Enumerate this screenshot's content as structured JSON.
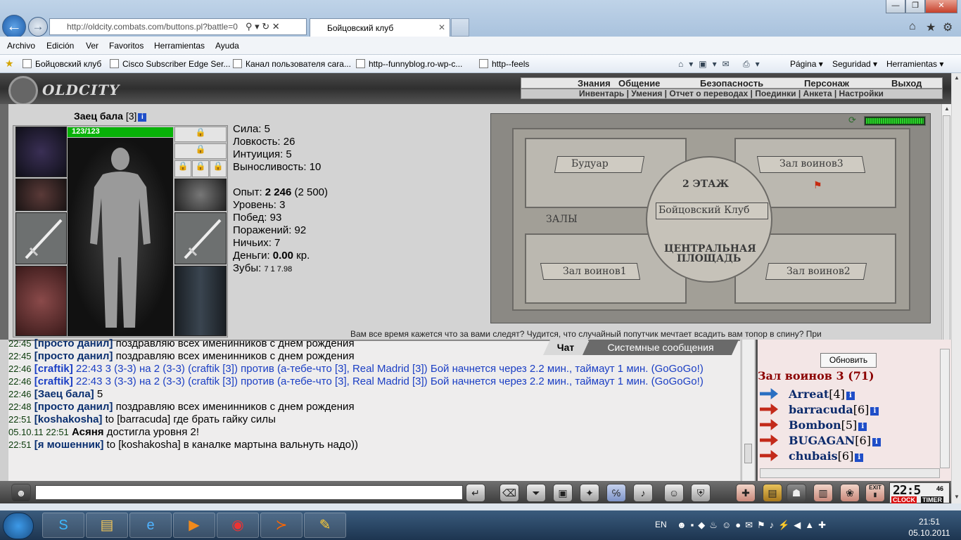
{
  "browser": {
    "address": "http://oldcity.combats.com/buttons.pl?battle=0",
    "tab_title": "Бойцовский клуб",
    "menu": [
      "Archivo",
      "Edición",
      "Ver",
      "Favoritos",
      "Herramientas",
      "Ayuda"
    ],
    "favorites": [
      "Бойцовский клуб",
      "Cisco Subscriber Edge Ser...",
      "Канал пользователя cara...",
      "http--funnyblog.ro-wp-c...",
      "http--feels"
    ],
    "commands": [
      "Página ▾",
      "Seguridad ▾",
      "Herramientas ▾"
    ],
    "icons": [
      "back-icon",
      "forward-icon",
      "home-icon",
      "star-icon",
      "gear-icon"
    ]
  },
  "game": {
    "logo": "OLDCITY",
    "top_menu": [
      "Знания",
      "Общение",
      "Безопасность",
      "Персонаж",
      "Выход"
    ],
    "sub_menu": "Инвентарь | Умения | Отчет о переводах | Поединки | Анкета | Настройки",
    "character": {
      "name": "Заец бала",
      "level": "[3]",
      "info": "i",
      "hp": "123/123",
      "hp_fraction": 1.0
    },
    "stats": {
      "strength": "Сила: 5",
      "agility": "Ловкость: 26",
      "intuition": "Интуиция: 5",
      "endurance": "Выносливость: 10",
      "exp_label": "Опыт: ",
      "exp_value": "2 246",
      "exp_next": " (2 500)",
      "level": "Уровень: 3",
      "wins": "Побед: 93",
      "losses": "Поражений: 92",
      "draws": "Ничьих: 7",
      "money_label": "Деньги: ",
      "money_value": "0.00",
      "money_unit": " кр.",
      "teeth_label": "Зубы: ",
      "teeth_values": "7  1  7.98"
    },
    "map": {
      "labels": [
        "Будуар",
        "Зал воинов3",
        "2 ЭТАЖ",
        "Бойцовский Клуб",
        "ЗАЛЫ",
        "ЦЕНТРАЛЬНАЯ",
        "ПЛОЩАДЬ",
        "Зал воинов1",
        "Зал воинов2"
      ]
    },
    "message_line": "Вам все время кажется что за вами следят? Чудится, что случайный попутчик мечтает всадить вам топор в спину? При",
    "chat_tabs": {
      "chat": "Чат",
      "system": "Системные сообщения"
    },
    "chat": [
      {
        "time": "22:45",
        "name": "[просто данил]",
        "text": " поздравляю всех именинников с днем рождения",
        "style": "normal"
      },
      {
        "time": "22:45",
        "name": "[просто данил]",
        "text": " поздравляю всех именинников с днем рождения",
        "style": "normal"
      },
      {
        "time": "22:46",
        "name": "[craftik]",
        "text": " 22:43 3 (3-3) на 2 (3-3) (craftik [3]) против (а-тебе-что [3], Real Madrid [3]) Бой начнется через 2.2 мин., таймаут 1 мин. (GoGoGo!)",
        "style": "blue"
      },
      {
        "time": "22:46",
        "name": "[craftik]",
        "text": " 22:43 3 (3-3) на 2 (3-3) (craftik [3]) против (а-тебе-что [3], Real Madrid [3]) Бой начнется через 2.2 мин., таймаут 1 мин. (GoGoGo!)",
        "style": "blue"
      },
      {
        "time": "22:46",
        "name": "[Заец бала]",
        "text": " 5",
        "style": "normal"
      },
      {
        "time": "22:48",
        "name": "[просто данил]",
        "text": " поздравляю всех именинников с днем рождения",
        "style": "normal"
      },
      {
        "time": "22:51",
        "name": "[koshakosha]",
        "text": " to [barracuda] где брать гайку силы",
        "style": "normal"
      },
      {
        "time": "05.10.11 22:51",
        "name": "Асяня",
        "text": " достигла уровня 2!",
        "style": "system"
      },
      {
        "time": "22:51",
        "name": "[я мошенник]",
        "text": " to [koshakosha] в каналке мартына вальнуть надо))",
        "style": "normal"
      }
    ],
    "room": {
      "refresh": "Обновить",
      "title": "Зал воинов 3 (71)",
      "players": [
        {
          "name": "Arreat",
          "level": "[4]"
        },
        {
          "name": "barracuda",
          "level": "[6]"
        },
        {
          "name": "Bombon",
          "level": "[5]"
        },
        {
          "name": "BUGAGAN",
          "level": "[6]"
        },
        {
          "name": "chubais",
          "level": "[6]"
        }
      ]
    },
    "clock": {
      "time": "22:5",
      "seconds": "46",
      "clock_label": "CLOCK",
      "timer_label": "TIMER",
      "exit_label": "EXIT"
    }
  },
  "taskbar": {
    "lang": "EN",
    "time": "21:51",
    "date": "05.10.2011"
  },
  "colors": {
    "chat_blue": "#1a3ec4",
    "room_title": "#8b0000",
    "hp_green": "#08b208"
  }
}
